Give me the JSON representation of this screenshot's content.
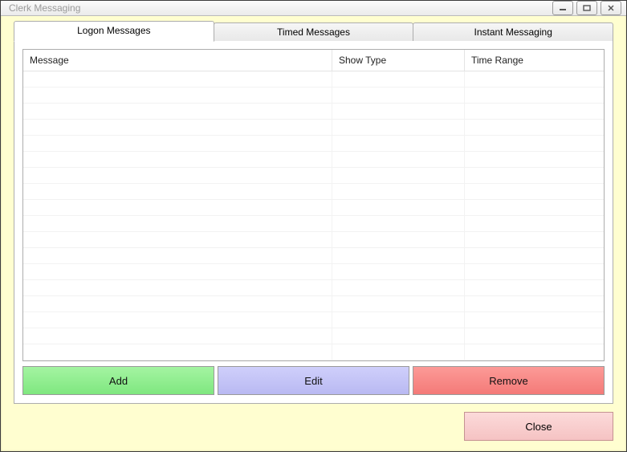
{
  "window": {
    "title": "Clerk Messaging"
  },
  "tabs": [
    {
      "label": "Logon Messages",
      "active": true
    },
    {
      "label": "Timed Messages",
      "active": false
    },
    {
      "label": "Instant Messaging",
      "active": false
    }
  ],
  "grid": {
    "headers": {
      "message": "Message",
      "show_type": "Show Type",
      "time_range": "Time Range"
    },
    "rows": []
  },
  "buttons": {
    "add": "Add",
    "edit": "Edit",
    "remove": "Remove",
    "close": "Close"
  }
}
